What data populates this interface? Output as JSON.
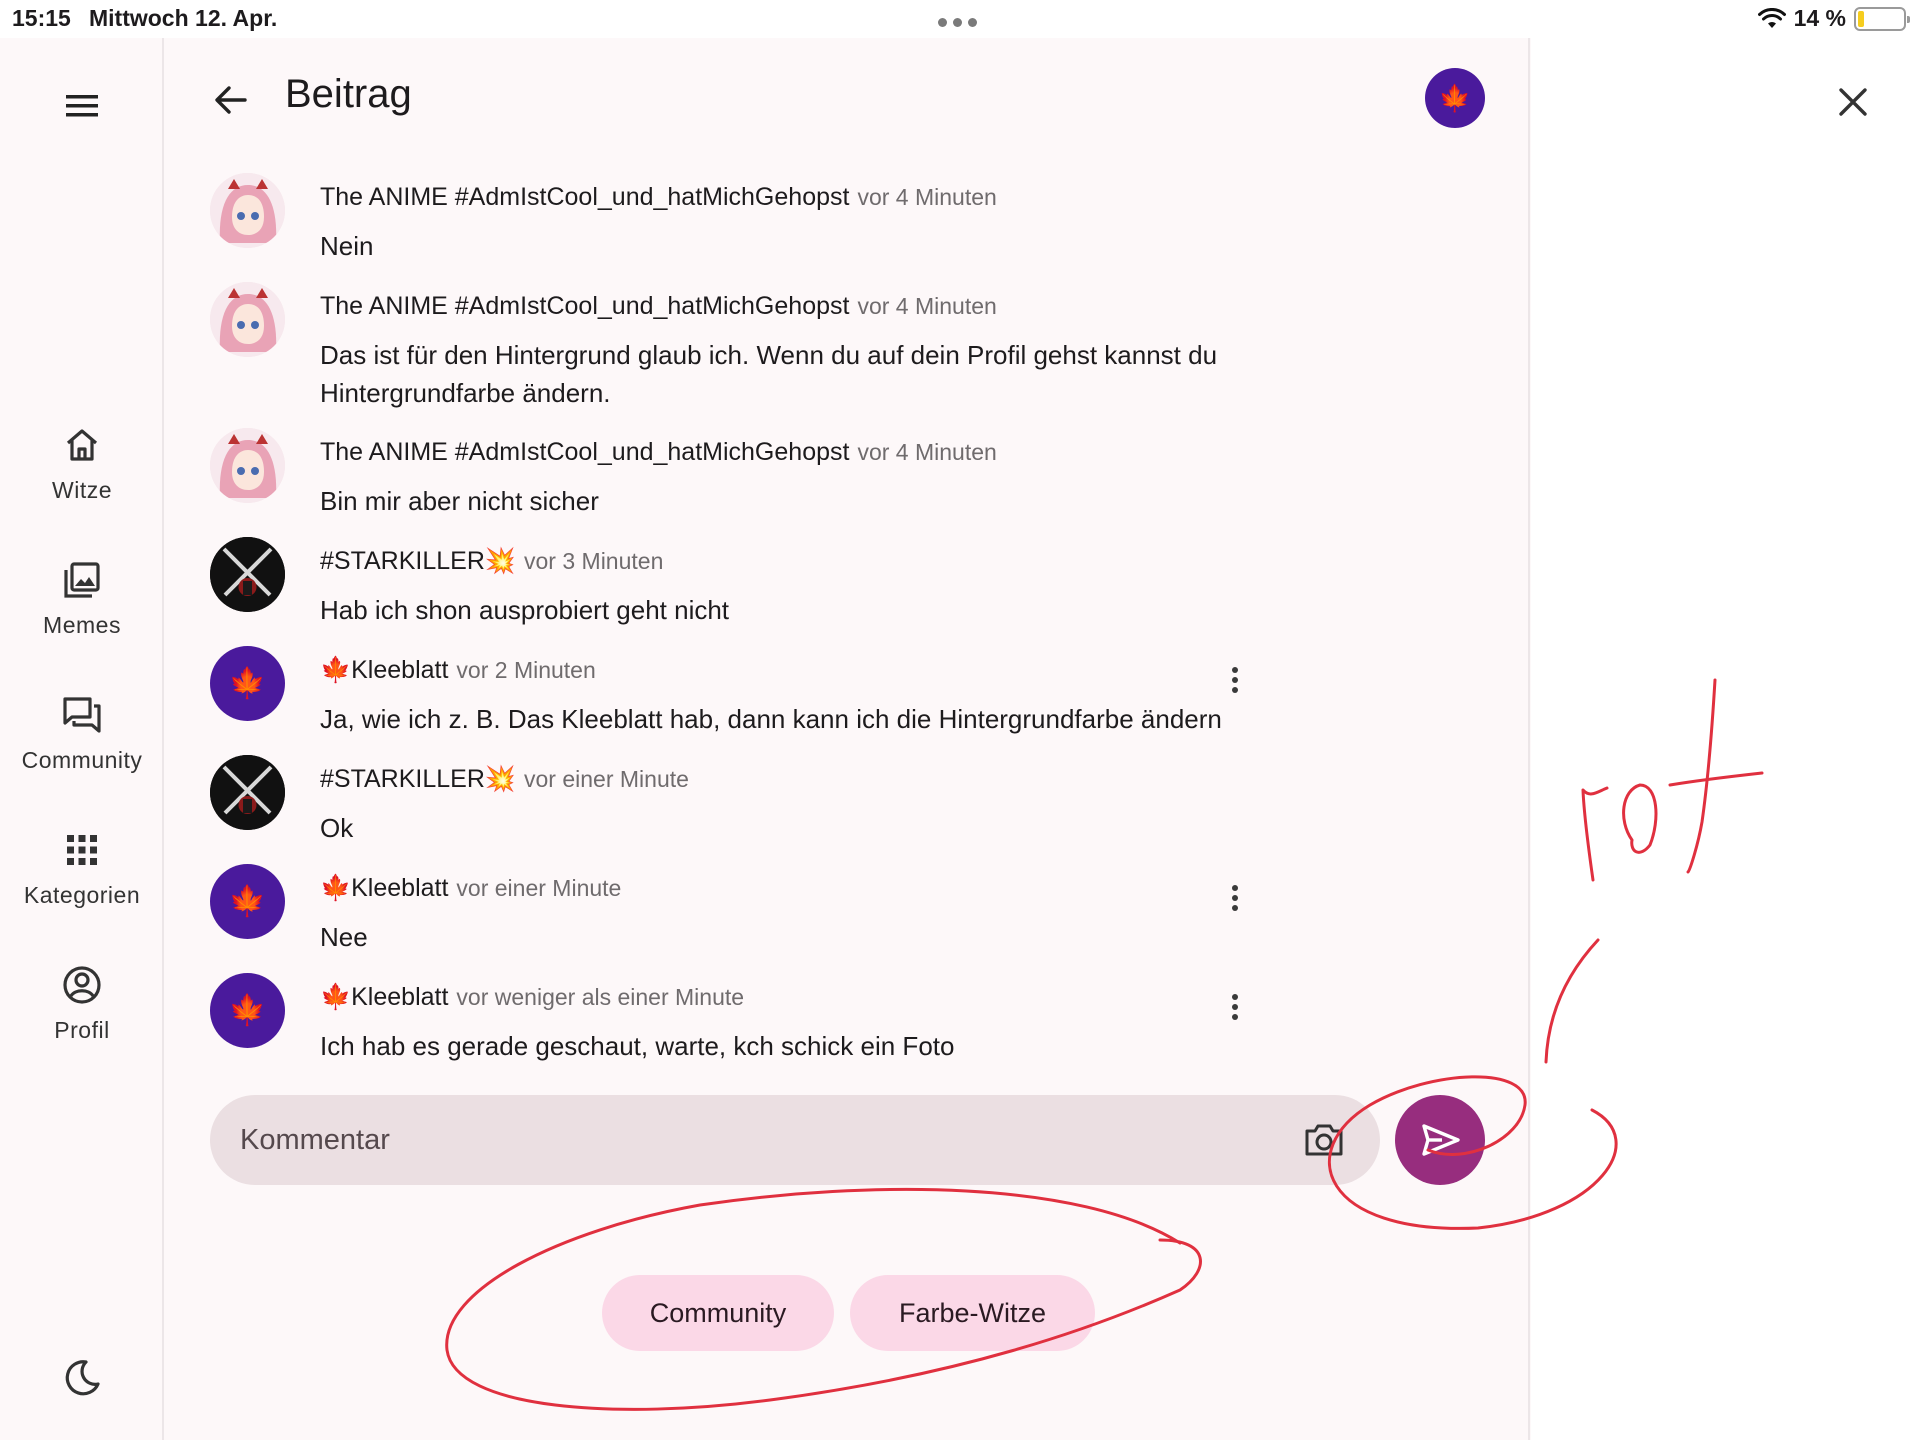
{
  "status_bar": {
    "time": "15:15",
    "date": "Mittwoch 12. Apr.",
    "battery": "14 %",
    "battery_level": 0.14
  },
  "rail": {
    "menu_icon": "menu-icon",
    "items": [
      {
        "label": "Witze",
        "icon": "home-icon"
      },
      {
        "label": "Memes",
        "icon": "gallery-icon"
      },
      {
        "label": "Community",
        "icon": "forum-icon"
      },
      {
        "label": "Kategorien",
        "icon": "apps-grid-icon"
      },
      {
        "label": "Profil",
        "icon": "account-circle-icon"
      }
    ],
    "theme_icon": "dark-mode-icon"
  },
  "header": {
    "title": "Beitrag",
    "back_icon": "arrow-back-icon"
  },
  "comments": [
    {
      "author": "The ANIME #AdmIstCool_und_hatMichGehopst",
      "time": "vor 4 Minuten",
      "text": "Nein",
      "avatar": "anime"
    },
    {
      "author": "The ANIME #AdmIstCool_und_hatMichGehopst",
      "time": "vor 4 Minuten",
      "text": "Das ist für den Hintergrund glaub ich. Wenn du auf dein Profil gehst kannst du Hintergrundfarbe ändern.",
      "avatar": "anime"
    },
    {
      "author": "The ANIME #AdmIstCool_und_hatMichGehopst",
      "time": "vor 4 Minuten",
      "text": "Bin mir aber nicht sicher",
      "avatar": "anime"
    },
    {
      "author": "#STARKILLER💥",
      "time": "vor 3 Minuten",
      "text": "Hab ich shon ausprobiert geht nicht",
      "avatar": "starkiller"
    },
    {
      "author": "🍁Kleeblatt",
      "time": "vor 2 Minuten",
      "text": "Ja, wie ich z. B. Das Kleeblatt hab, dann kann ich die Hintergrundfarbe ändern",
      "avatar": "kleeblatt"
    },
    {
      "author": "#STARKILLER💥",
      "time": "vor einer Minute",
      "text": "Ok",
      "avatar": "starkiller"
    },
    {
      "author": "🍁Kleeblatt",
      "time": "vor einer Minute",
      "text": "Nee",
      "avatar": "kleeblatt"
    },
    {
      "author": "🍁Kleeblatt",
      "time": "vor weniger als einer Minute",
      "text": "Ich hab es gerade geschaut, warte, kch schick ein Foto",
      "avatar": "kleeblatt"
    }
  ],
  "comment_input": {
    "placeholder": "Kommentar",
    "value": "",
    "camera_icon": "camera-icon",
    "send_icon": "send-icon"
  },
  "chips": [
    {
      "label": "Community"
    },
    {
      "label": "Farbe-Witze"
    }
  ],
  "annotation": {
    "handwriting": "rot",
    "ink_color": "#e0303f"
  },
  "colors": {
    "accent": "#972d7e",
    "chip_bg": "#fbd8e7",
    "avatar_purple": "#4a1a9c",
    "input_bg": "#ebdfe2"
  }
}
